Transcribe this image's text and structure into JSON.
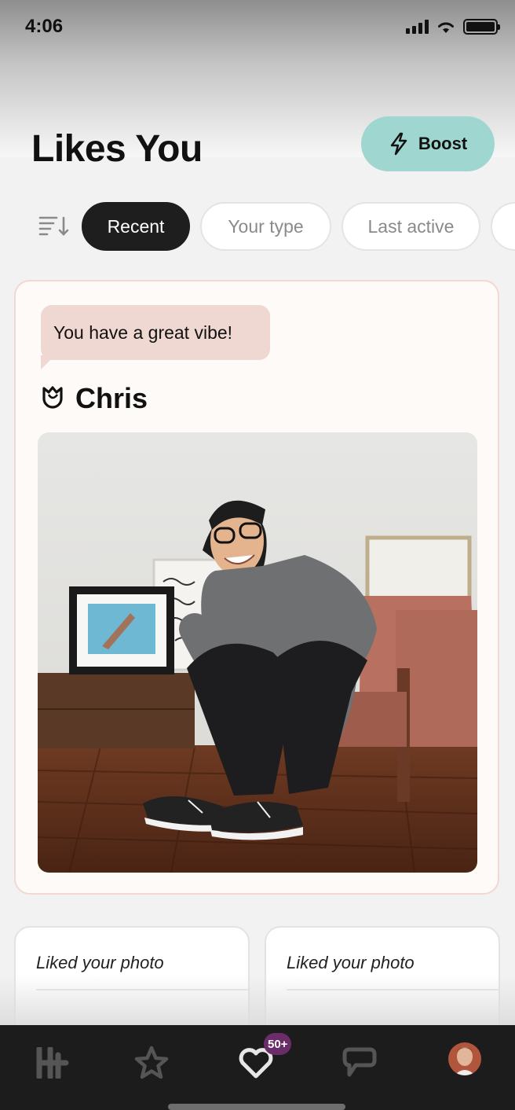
{
  "status_bar": {
    "time": "4:06"
  },
  "header": {
    "title": "Likes You",
    "boost_label": "Boost"
  },
  "filters": {
    "chips": [
      {
        "label": "Recent",
        "active": true
      },
      {
        "label": "Your type",
        "active": false
      },
      {
        "label": "Last active",
        "active": false
      }
    ]
  },
  "like_card": {
    "message": "You have a great vibe!",
    "name": "Chris",
    "badge_icon": "rose-icon",
    "photo_alt": "profile-photo"
  },
  "mini_cards": [
    {
      "label": "Liked your photo"
    },
    {
      "label": "Liked your photo"
    }
  ],
  "tab_bar": {
    "items": [
      {
        "name": "home",
        "icon": "hinge-logo-icon"
      },
      {
        "name": "standouts",
        "icon": "star-icon"
      },
      {
        "name": "likes",
        "icon": "heart-icon",
        "badge": "50+"
      },
      {
        "name": "matches",
        "icon": "chat-bubble-icon"
      },
      {
        "name": "profile",
        "icon": "avatar"
      }
    ]
  },
  "colors": {
    "boost_bg": "#9fd6d0",
    "bubble_bg": "#f0d8d2",
    "card_border": "#f3d7d3",
    "badge_bg": "#6b2d6a",
    "tab_bar_bg": "#1c1c1c"
  }
}
